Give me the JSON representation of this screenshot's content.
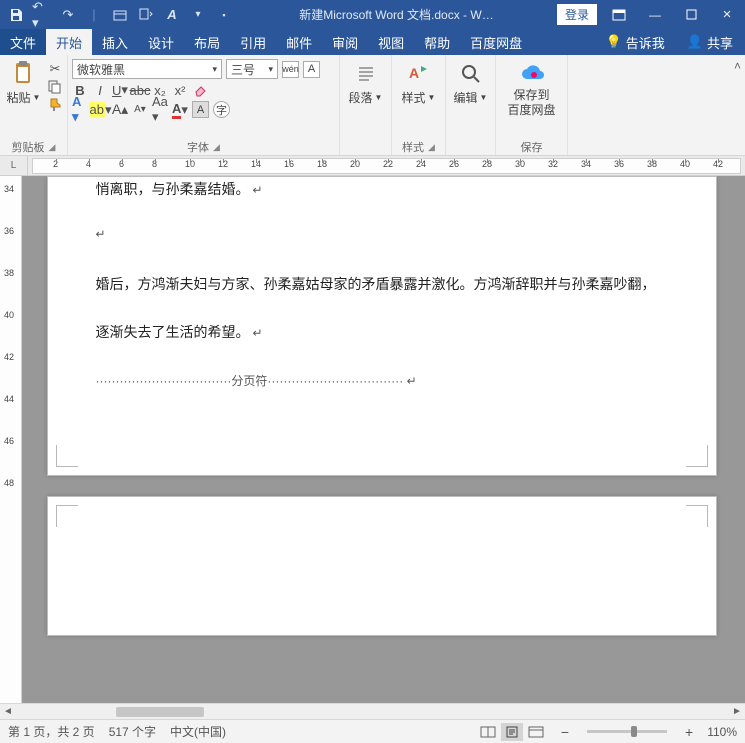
{
  "title": "新建Microsoft Word 文档.docx - W…",
  "login": "登录",
  "tabs": {
    "file": "文件",
    "home": "开始",
    "insert": "插入",
    "design": "设计",
    "layout": "布局",
    "references": "引用",
    "mail": "邮件",
    "review": "审阅",
    "view": "视图",
    "help": "帮助",
    "baidu": "百度网盘",
    "tell": "告诉我",
    "share": "共享"
  },
  "ribbon": {
    "clipboard": {
      "paste": "粘贴",
      "label": "剪贴板"
    },
    "font": {
      "name": "微软雅黑",
      "size": "三号",
      "ruby": "wén",
      "label": "字体"
    },
    "paragraph": {
      "btn": "段落"
    },
    "styles": {
      "btn": "样式",
      "label": "样式"
    },
    "editing": {
      "btn": "编辑"
    },
    "save": {
      "btn1": "保存到",
      "btn2": "百度网盘",
      "label": "保存"
    }
  },
  "ruler": {
    "marks": [
      2,
      4,
      6,
      8,
      10,
      12,
      14,
      16,
      18,
      20,
      22,
      24,
      26,
      28,
      30,
      32,
      34,
      36,
      38,
      40,
      42
    ]
  },
  "vruler": {
    "marks": [
      34,
      36,
      38,
      40,
      42,
      44,
      46,
      48
    ]
  },
  "doc": {
    "partial": "悄离职，与孙柔嘉结婚。",
    "p1": "婚后，方鸿渐夫妇与方家、孙柔嘉姑母家的矛盾暴露并激化。方鸿渐辞职并与孙柔嘉吵翻，",
    "p2": "逐渐失去了生活的希望。",
    "break": "分页符"
  },
  "status": {
    "page": "第 1 页，共 2 页",
    "words": "517 个字",
    "lang": "中文(中国)",
    "zoom": "110%"
  }
}
